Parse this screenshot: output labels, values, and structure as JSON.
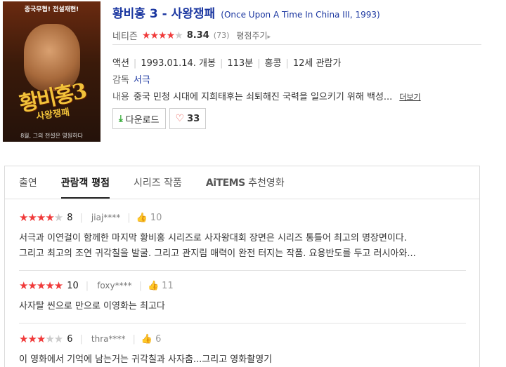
{
  "poster": {
    "banner": "중국무협! 전설재현!",
    "calligraphy": "황비홍3",
    "calligraphy_sub": "사왕쟁패",
    "caption": "8월, 그의 전설은 영원하다"
  },
  "movie": {
    "title": "황비홍 3 - 사왕쟁패",
    "english_title": "(Once Upon A Time In China III, 1993)",
    "rating_label": "네티즌",
    "rating_stars": 4,
    "rating_score": "8.34",
    "rating_count": "(73)",
    "rate_link": "평점주기",
    "genre": "액션",
    "release": "1993.01.14. 개봉",
    "runtime": "113분",
    "country": "홍콩",
    "age": "12세 관람가",
    "director_label": "감독",
    "director": "서극",
    "plot_label": "내용",
    "plot": "중국 민청 시대에 지희태후는 쇠퇴해진 국력을 일으키기 위해 백성...",
    "more_label": "더보기",
    "download_label": "다운로드",
    "like_count": "33"
  },
  "tabs": [
    {
      "label": "출연"
    },
    {
      "label": "관람객 평점"
    },
    {
      "label": "시리즈 작품"
    },
    {
      "brand": "AiTEMS",
      "label": " 추천영화"
    }
  ],
  "reviews": [
    {
      "stars": 4,
      "score": "8",
      "user": "jiaj****",
      "likes": "10",
      "line1": "서극과 이연걸이 함께한 마지막 황비홍 시리즈로 사자왕대회 장면은 시리즈 통틀어 최고의 명장면이다.",
      "line2": "그리고 최고의 조연 귀각칠을 발굴. 그리고 관지림 매력이 완전 터지는 작품. 요용반도를 두고 러시아와..."
    },
    {
      "stars": 5,
      "score": "10",
      "user": "foxy****",
      "likes": "11",
      "line1": "사자탈 씬으로 만으로 이영화는 최고다"
    },
    {
      "stars": 3,
      "score": "6",
      "user": "thra****",
      "likes": "6",
      "line1": "이 영화에서 기억에 남는거는 귀각칠과 사자춤...그리고 영화촬영기"
    }
  ],
  "colors": {
    "link_blue": "#1a36a0",
    "star_red": "#f03a3a",
    "download_green": "#2fa832",
    "heart_red": "#e8453c"
  },
  "icons": [
    "download-icon",
    "heart-icon",
    "thumbs-up-icon",
    "chevron-right-icon",
    "star-icon"
  ]
}
